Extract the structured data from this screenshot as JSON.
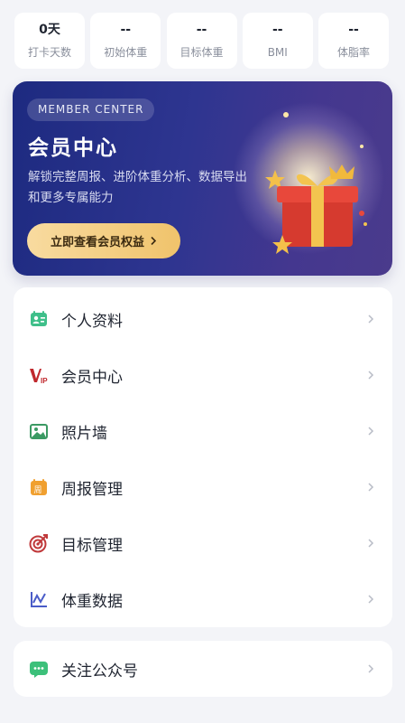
{
  "stats": [
    {
      "value": "0天",
      "label": "打卡天数"
    },
    {
      "value": "--",
      "label": "初始体重"
    },
    {
      "value": "--",
      "label": "目标体重"
    },
    {
      "value": "--",
      "label": "BMI"
    },
    {
      "value": "--",
      "label": "体脂率"
    }
  ],
  "banner": {
    "tag": "MEMBER CENTER",
    "title": "会员中心",
    "description": "解锁完整周报、进阶体重分析、数据导出和更多专属能力",
    "button_label": "立即查看会员权益",
    "button_icon": "chevron-right-icon"
  },
  "menu": [
    {
      "label": "个人资料",
      "icon": "profile-card-icon",
      "color": "#3fbf8a"
    },
    {
      "label": "会员中心",
      "icon": "vip-icon",
      "color": "#c0282d"
    },
    {
      "label": "照片墙",
      "icon": "photo-icon",
      "color": "#3b9a63"
    },
    {
      "label": "周报管理",
      "icon": "calendar-week-icon",
      "color": "#f0a030"
    },
    {
      "label": "目标管理",
      "icon": "target-icon",
      "color": "#c0393b"
    },
    {
      "label": "体重数据",
      "icon": "chart-icon",
      "color": "#4a5cc8"
    }
  ],
  "menu2": [
    {
      "label": "关注公众号",
      "icon": "wechat-icon",
      "color": "#3cc07a"
    }
  ],
  "colors": {
    "accent_gold": "#f0c36b",
    "banner_bg": "#2e3590"
  }
}
